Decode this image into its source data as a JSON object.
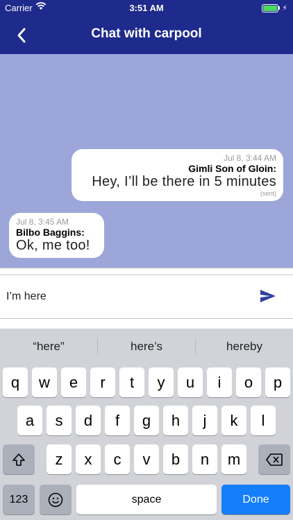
{
  "status": {
    "carrier": "Carrier",
    "time": "3:51 AM"
  },
  "nav": {
    "title": "Chat with carpool"
  },
  "messages": [
    {
      "time": "Jul 8, 3:44 AM",
      "author": "Gimli Son of Gloin:",
      "text": "Hey, I’ll be there in 5 minutes",
      "status": "(sent)"
    },
    {
      "time": "Jul 8, 3:45 AM",
      "author": "Bilbo Baggins:",
      "text": "Ok, me too!"
    }
  ],
  "composer": {
    "value": "I’m here"
  },
  "keyboard": {
    "suggestions": [
      "“here”",
      "here’s",
      "hereby"
    ],
    "row1": [
      "q",
      "w",
      "e",
      "r",
      "t",
      "y",
      "u",
      "i",
      "o",
      "p"
    ],
    "row2": [
      "a",
      "s",
      "d",
      "f",
      "g",
      "h",
      "j",
      "k",
      "l"
    ],
    "row3": [
      "z",
      "x",
      "c",
      "v",
      "b",
      "n",
      "m"
    ],
    "numbers_label": "123",
    "space_label": "space",
    "done_label": "Done"
  },
  "colors": {
    "nav_bg": "#1e2a8c",
    "chat_bg": "#9ca6d9",
    "send_icon": "#2f3fa0",
    "done_key": "#147efb"
  }
}
